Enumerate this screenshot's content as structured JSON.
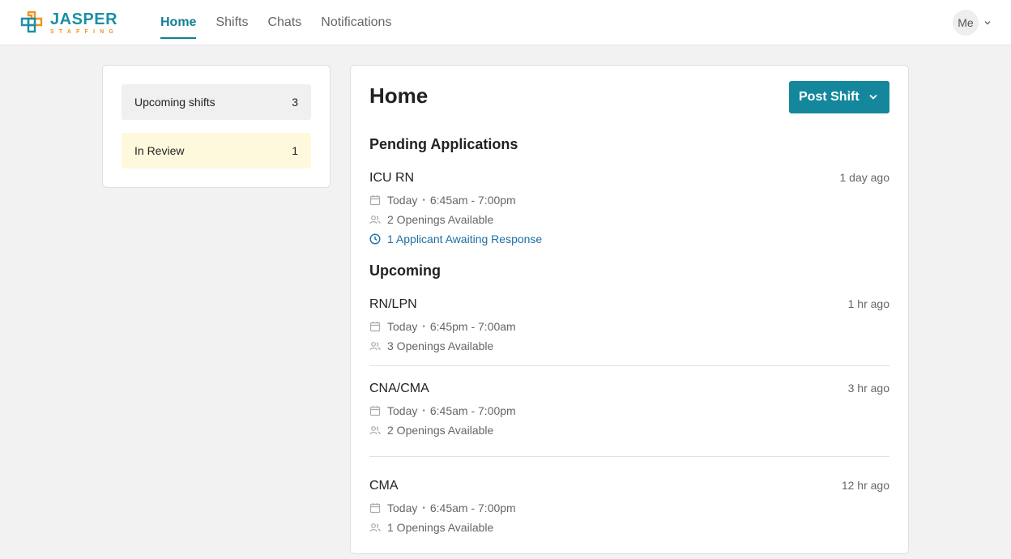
{
  "brand": {
    "name": "JASPER",
    "tagline": "STAFFING"
  },
  "nav": {
    "items": [
      {
        "label": "Home",
        "active": true
      },
      {
        "label": "Shifts",
        "active": false
      },
      {
        "label": "Chats",
        "active": false
      },
      {
        "label": "Notifications",
        "active": false
      }
    ]
  },
  "user": {
    "avatar_label": "Me"
  },
  "sidebar": {
    "items": [
      {
        "label": "Upcoming shifts",
        "count": "3"
      },
      {
        "label": "In Review",
        "count": "1"
      }
    ]
  },
  "main": {
    "title": "Home",
    "post_button": "Post Shift",
    "pending": {
      "title": "Pending Applications",
      "shifts": [
        {
          "title": "ICU RN",
          "ago": "1 day ago",
          "day": "Today",
          "time": "6:45am - 7:00pm",
          "openings": "2 Openings Available",
          "applicants": "1 Applicant Awaiting Response"
        }
      ]
    },
    "upcoming": {
      "title": "Upcoming",
      "shifts": [
        {
          "title": "RN/LPN",
          "ago": "1 hr ago",
          "day": "Today",
          "time": "6:45pm - 7:00am",
          "openings": "3 Openings Available"
        },
        {
          "title": "CNA/CMA",
          "ago": "3 hr ago",
          "day": "Today",
          "time": "6:45am - 7:00pm",
          "openings": "2 Openings Available"
        },
        {
          "title": "CMA",
          "ago": "12 hr ago",
          "day": "Today",
          "time": "6:45am - 7:00pm",
          "openings": "1 Openings Available"
        }
      ]
    }
  },
  "colors": {
    "brand_teal": "#14879c",
    "brand_orange": "#f0931e",
    "link_blue": "#1f6fa6",
    "review_bg": "#fef9dd"
  }
}
